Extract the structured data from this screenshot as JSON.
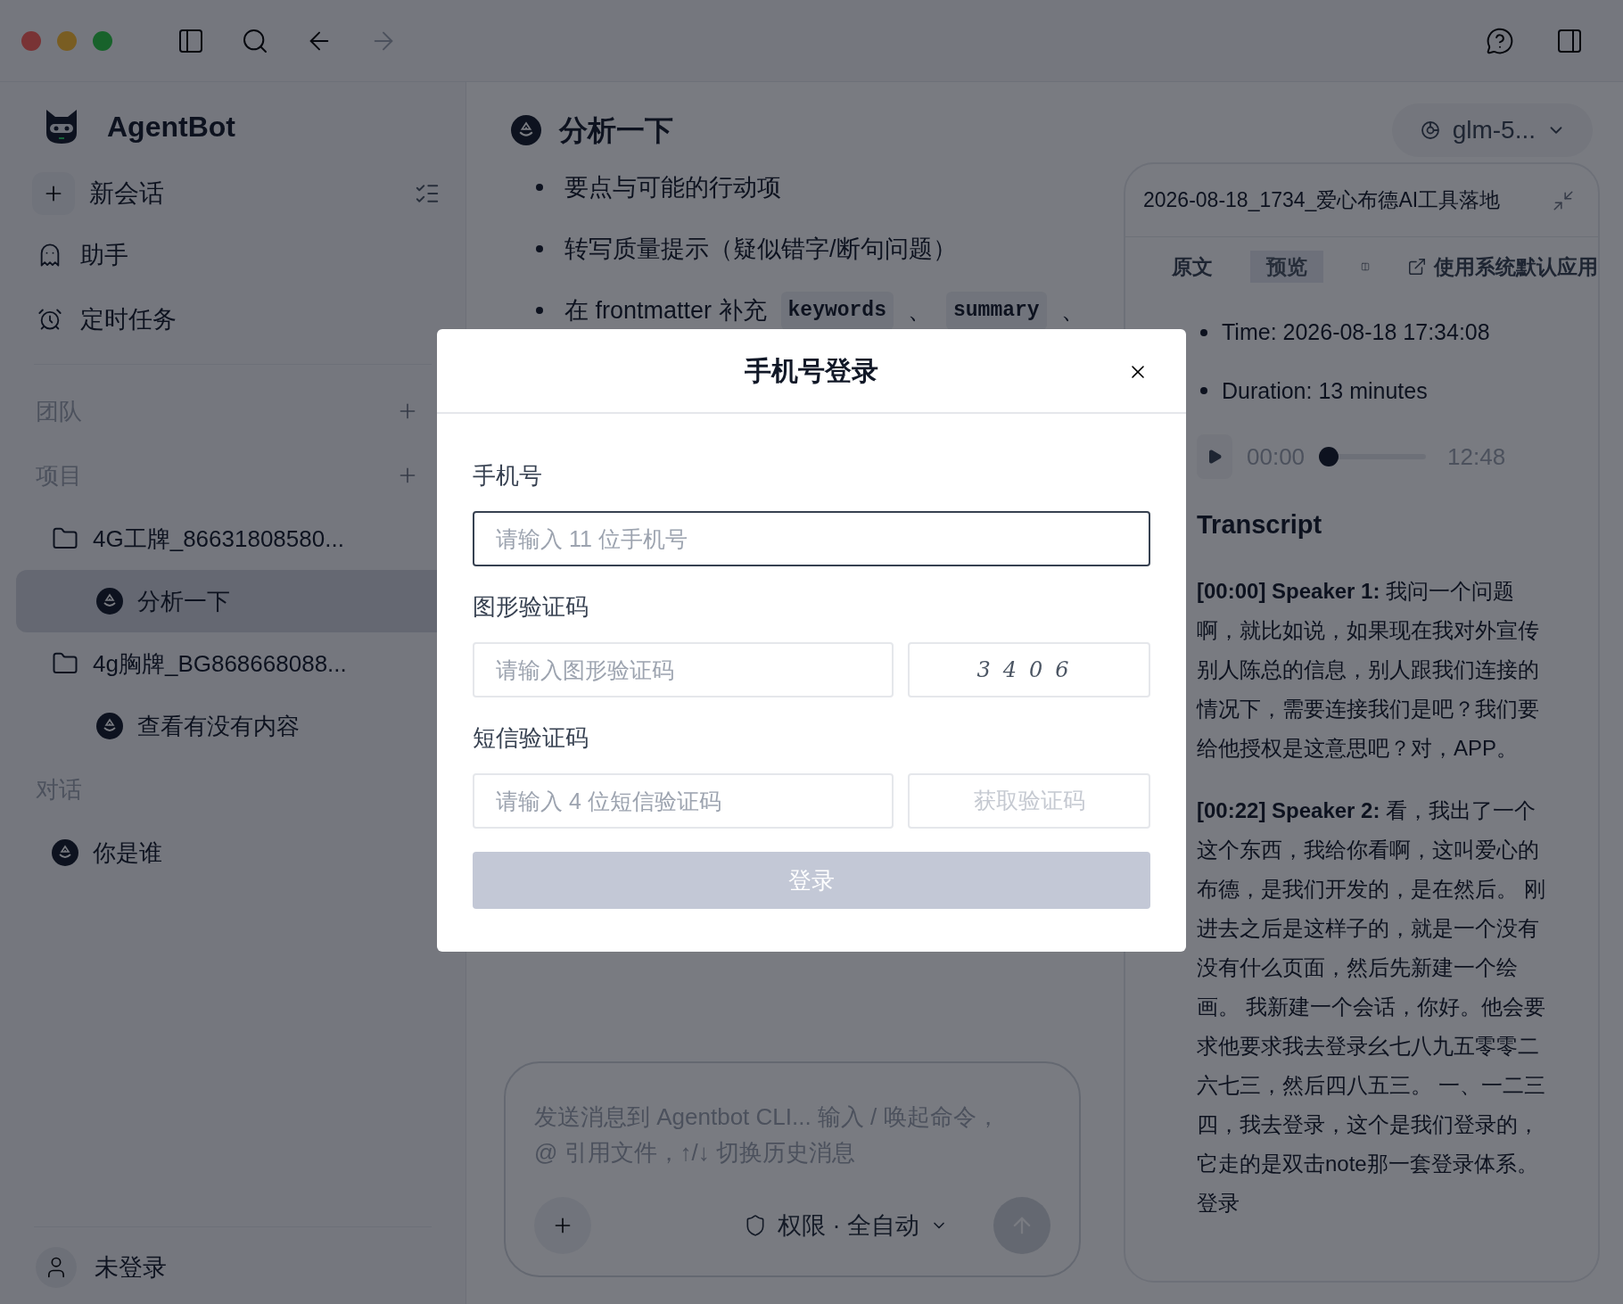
{
  "sidebar": {
    "app_name": "AgentBot",
    "new_chat": "新会话",
    "nav": [
      {
        "label": "助手",
        "kind": "assistant"
      },
      {
        "label": "定时任务",
        "kind": "schedule"
      }
    ],
    "sections": [
      {
        "title": "团队",
        "add_button": true
      },
      {
        "title": "项目",
        "add_button": true,
        "items": [
          {
            "label": "4G工牌_86631808580...",
            "kind": "folder",
            "children": [
              {
                "label": "分析一下",
                "kind": "chat",
                "selected": true
              }
            ]
          },
          {
            "label": "4g胸牌_BG868668088...",
            "kind": "folder",
            "children": [
              {
                "label": "查看有没有内容",
                "kind": "chat",
                "selected": false
              }
            ]
          }
        ]
      },
      {
        "title": "对话",
        "add_button": false,
        "items": [
          {
            "label": "你是谁",
            "kind": "chat",
            "selected": false
          }
        ]
      }
    ],
    "user": {
      "label": "未登录"
    }
  },
  "main": {
    "title": "分析一下",
    "model": "glm-5...",
    "bullets": [
      [
        {
          "kind": "text",
          "text": "要点与可能的行动项"
        }
      ],
      [
        {
          "kind": "text",
          "text": "转写质量提示（疑似错字/断句问题）"
        }
      ],
      [
        {
          "kind": "text",
          "text": "在 frontmatter 补充"
        },
        {
          "kind": "code",
          "text": "keywords"
        },
        {
          "kind": "text",
          "text": "、"
        },
        {
          "kind": "code",
          "text": "summary"
        },
        {
          "kind": "text",
          "text": "、"
        }
      ]
    ],
    "composer": {
      "placeholder": "发送消息到 Agentbot CLI...  输入 / 唤起命令，@ 引用文件，↑/↓ 切换历史消息",
      "permission": "权限 · 全自动"
    }
  },
  "preview": {
    "title": "2026-08-18_1734_爱心布德AI工具落地",
    "tabs": [
      {
        "label": "原文",
        "selected": false
      },
      {
        "label": "预览",
        "selected": true
      }
    ],
    "open_external": "使用系统默认应用",
    "meta": [
      "Time: 2026-08-18 17:34:08",
      "Duration: 13 minutes"
    ],
    "player": {
      "current": "00:00",
      "total": "12:48",
      "level": 0
    },
    "heading": "Transcript",
    "paragraphs": [
      "**[00:00] Speaker 1:** 我问一个问题啊，就比如说，如果现在我对外宣传别人陈总的信息，别人跟我们连接的情况下，需要连接我们是吧？我们要给他授权是这意思吧？对，APP。",
      "**[00:22] Speaker 2:** 看，我出了一个这个东西，我给你看啊，这叫爱心的布德，是我们开发的，是在然后。 刚进去之后是这样子的，就是一个没有没有什么页面，然后先新建一个绘画。 我新建一个会话，你好。他会要求他要求我去登录幺七八九五零零二六七三，然后四八五三。 一、一二三四，我去登录，这个是我们登录的，它走的是双击note那一套登录体系。登录"
    ]
  },
  "dialog": {
    "title": "手机号登录",
    "fields": [
      {
        "kind": "plain",
        "label": "手机号",
        "placeholder": "请输入 11 位手机号",
        "focused": true
      },
      {
        "kind": "captcha",
        "label": "图形验证码",
        "placeholder": "请输入图形验证码",
        "focused": false,
        "captcha": "3406"
      },
      {
        "kind": "sms",
        "label": "短信验证码",
        "placeholder": "请输入 4 位短信验证码",
        "focused": false,
        "button": {
          "label": "获取验证码",
          "disabled": true
        }
      }
    ],
    "submit": {
      "label": "登录",
      "disabled": true
    }
  }
}
